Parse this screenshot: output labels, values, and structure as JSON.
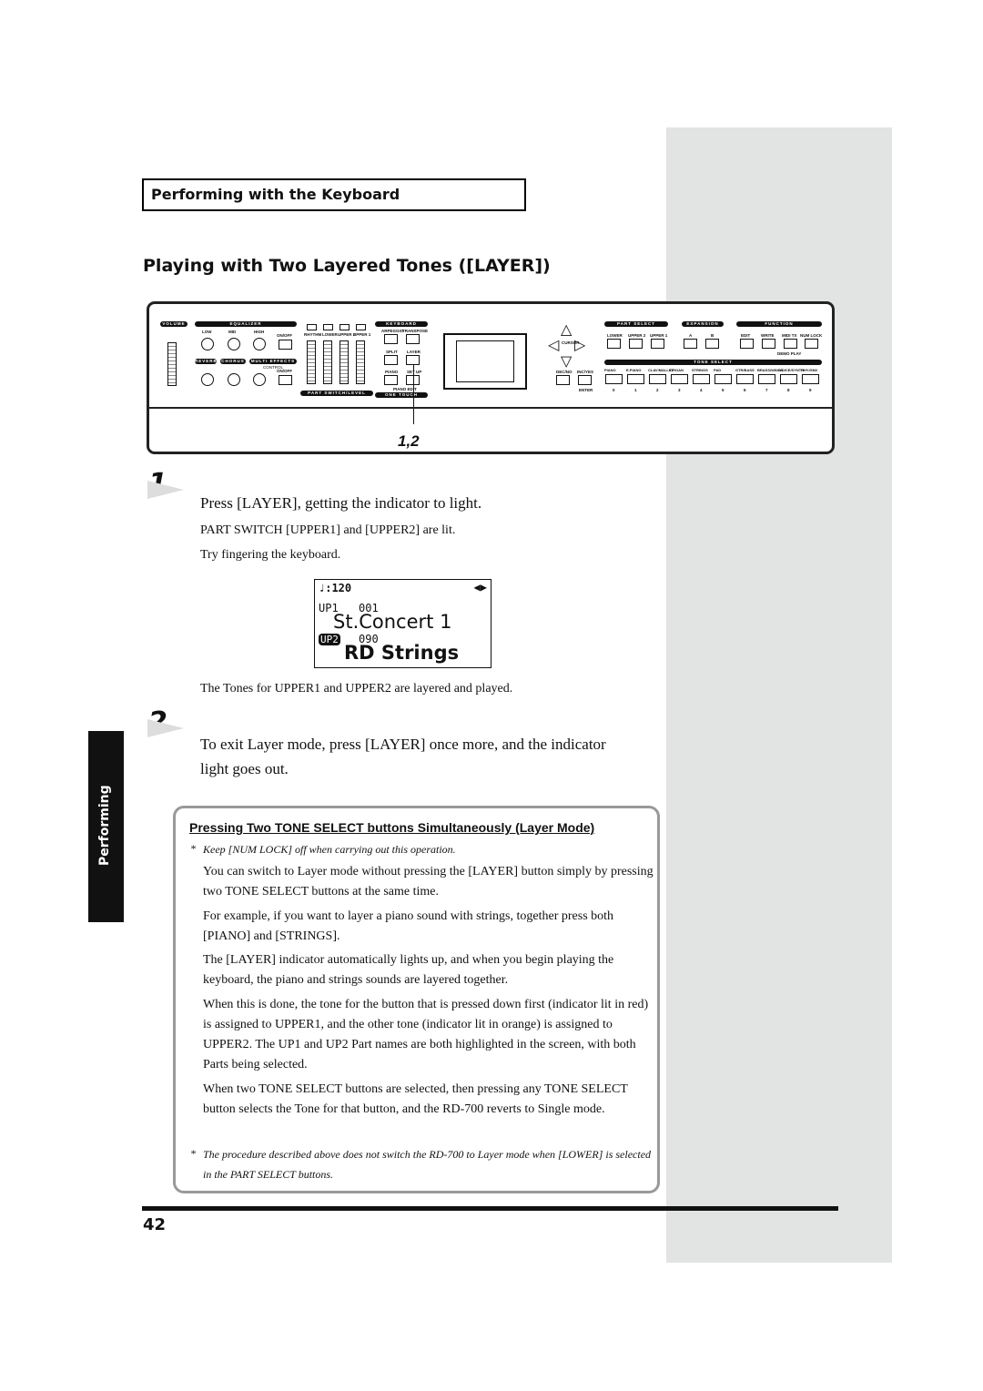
{
  "header": {
    "section": "Performing with the Keyboard",
    "title": "Playing with Two Layered Tones ([LAYER])"
  },
  "panel": {
    "left_bars": [
      "VOLUME",
      "EQUALIZER",
      "REVERB",
      "CHORUS",
      "MULTI EFFECTS",
      "PART SWITCH/LEVEL",
      "KEYBOARD CONTROL",
      "ONE TOUCH"
    ],
    "eq_labels": [
      "LOW",
      "MID",
      "HIGH"
    ],
    "on_off": "ON/OFF",
    "control": "CONTROL",
    "part_switches": [
      "RHYTHM",
      "LOWER",
      "UPPER 2",
      "UPPER 1"
    ],
    "kb_buttons": [
      "ARPEGGIO",
      "TRANSPOSE",
      "SPLIT",
      "LAYER",
      "PIANO",
      "SET UP"
    ],
    "piano_edit": "PIANO EDIT",
    "cursor": "CURSOR",
    "dec": "DEC/NO",
    "inc": "INC/YES",
    "enter": "ENTER",
    "part_select": {
      "title": "PART SELECT",
      "items": [
        "LOWER",
        "UPPER 2",
        "UPPER 1"
      ]
    },
    "expansion": {
      "title": "EXPANSION",
      "items": [
        "A",
        "B"
      ]
    },
    "function": {
      "title": "FUNCTION",
      "items": [
        "EDIT",
        "WRITE",
        "MIDI TX",
        "NUM LOCK"
      ],
      "demo": "DEMO PLAY"
    },
    "tone_select": {
      "title": "TONE SELECT",
      "items": [
        "PIANO",
        "E.PIANO",
        "CLAV/MALLET",
        "ORGAN",
        "STRINGS",
        "PAD",
        "GTR/BASS",
        "BRASS/WINDS",
        "VOICE/SYNTH",
        "RHY/GM2"
      ],
      "numbers": [
        "0",
        "1",
        "2",
        "3",
        "4",
        "5",
        "6",
        "7",
        "8",
        "9"
      ]
    },
    "callout": "1,2"
  },
  "steps": [
    {
      "num": "1",
      "main": "Press [LAYER], getting the indicator to light.",
      "sub": [
        "PART SWITCH [UPPER1] and [UPPER2] are lit.",
        "Try fingering the keyboard."
      ],
      "after": "The Tones for UPPER1 and UPPER2 are layered and played."
    },
    {
      "num": "2",
      "main": "To exit Layer mode, press [LAYER] once more, and the indicator light goes out."
    }
  ],
  "lcd": {
    "tempo": "♩:120",
    "arrows": "◀▶",
    "up1": "UP1",
    "up1_num": "001",
    "tone1": "St.Concert 1",
    "up2": "UP2",
    "up2_num": "090",
    "tone2": "RD Strings"
  },
  "side_tab": "Performing",
  "note": {
    "title": "Pressing Two TONE SELECT buttons Simultaneously (Layer Mode)",
    "caution1": "Keep [NUM LOCK] off when carrying out this operation.",
    "paras": [
      "You can switch to Layer mode without pressing the [LAYER] button simply by pressing two TONE SELECT buttons at the same time.",
      "For example, if you want to layer a piano sound with strings, together press both [PIANO] and [STRINGS].",
      "The [LAYER] indicator automatically lights up, and when you begin playing the keyboard, the piano and strings sounds are layered together.",
      "When this is done, the tone for the button that is pressed down first (indicator lit in red) is assigned to UPPER1, and the other tone (indicator lit in orange) is assigned to UPPER2. The UP1 and UP2 Part names are both highlighted in the screen, with both Parts being selected.",
      "When two TONE SELECT buttons are selected, then pressing any TONE SELECT button selects the Tone for that button, and the RD-700 reverts to Single mode."
    ],
    "caution2": "The procedure described above does not switch the RD-700 to Layer mode when [LOWER] is selected in the PART SELECT buttons.",
    "asterisk": "*"
  },
  "page_number": "42"
}
